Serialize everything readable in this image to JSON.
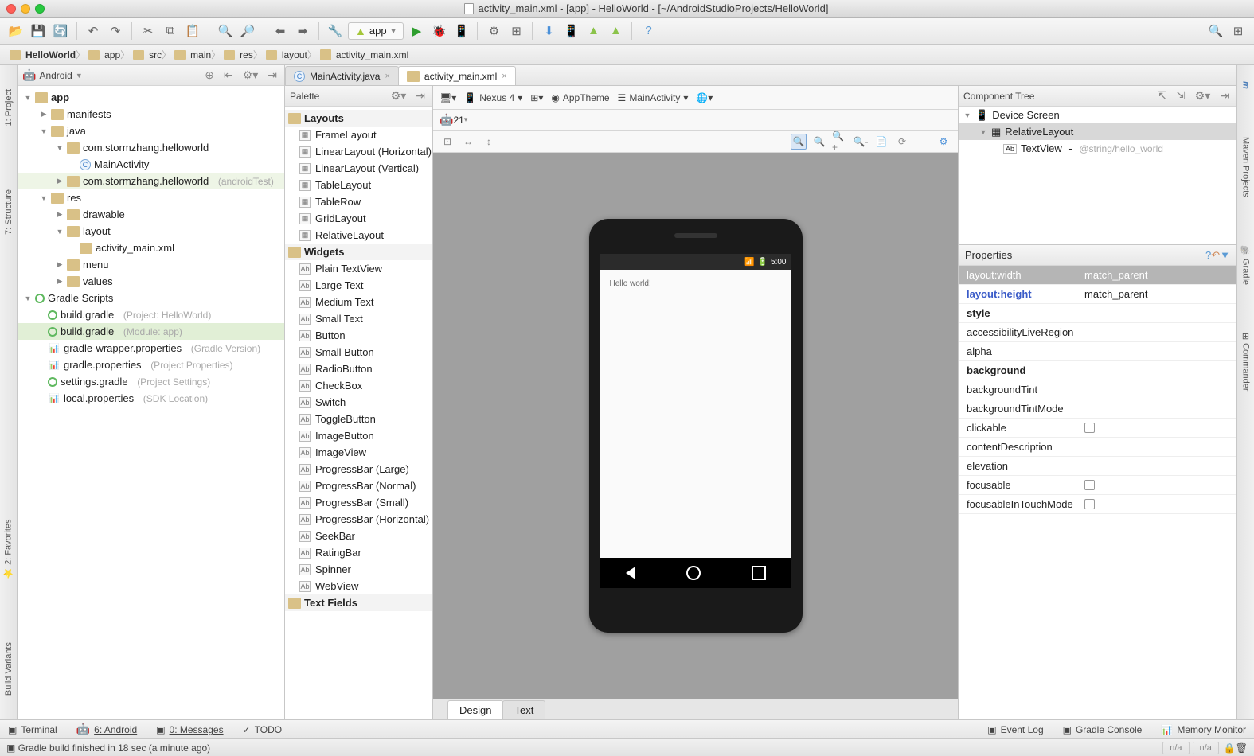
{
  "window_title": "activity_main.xml - [app] - HelloWorld - [~/AndroidStudioProjects/HelloWorld]",
  "app_selector": "app",
  "breadcrumb": [
    "HelloWorld",
    "app",
    "src",
    "main",
    "res",
    "layout",
    "activity_main.xml"
  ],
  "project_pane": {
    "mode": "Android",
    "tree": {
      "app": "app",
      "manifests": "manifests",
      "java": "java",
      "pkg1": "com.stormzhang.helloworld",
      "mainactivity": "MainActivity",
      "pkg2": "com.stormzhang.helloworld",
      "pkg2_hint": "(androidTest)",
      "res": "res",
      "drawable": "drawable",
      "layout": "layout",
      "layout_file": "activity_main.xml",
      "menu": "menu",
      "values": "values",
      "gradle_scripts": "Gradle Scripts",
      "bg1": "build.gradle",
      "bg1_hint": "(Project: HelloWorld)",
      "bg2": "build.gradle",
      "bg2_hint": "(Module: app)",
      "gwp": "gradle-wrapper.properties",
      "gwp_hint": "(Gradle Version)",
      "gp": "gradle.properties",
      "gp_hint": "(Project Properties)",
      "sg": "settings.gradle",
      "sg_hint": "(Project Settings)",
      "lp": "local.properties",
      "lp_hint": "(SDK Location)"
    }
  },
  "tabs": [
    {
      "label": "MainActivity.java",
      "active": false
    },
    {
      "label": "activity_main.xml",
      "active": true
    }
  ],
  "palette": {
    "title": "Palette",
    "layouts_label": "Layouts",
    "layouts": [
      "FrameLayout",
      "LinearLayout (Horizontal)",
      "LinearLayout (Vertical)",
      "TableLayout",
      "TableRow",
      "GridLayout",
      "RelativeLayout"
    ],
    "widgets_label": "Widgets",
    "widgets": [
      "Plain TextView",
      "Large Text",
      "Medium Text",
      "Small Text",
      "Button",
      "Small Button",
      "RadioButton",
      "CheckBox",
      "Switch",
      "ToggleButton",
      "ImageButton",
      "ImageView",
      "ProgressBar (Large)",
      "ProgressBar (Normal)",
      "ProgressBar (Small)",
      "ProgressBar (Horizontal)",
      "SeekBar",
      "RatingBar",
      "Spinner",
      "WebView"
    ],
    "textfields_label": "Text Fields"
  },
  "designer": {
    "device": "Nexus 4",
    "theme": "AppTheme",
    "activity": "MainActivity",
    "api": "21",
    "status_time": "5:00",
    "app_text": "Hello world!"
  },
  "component_tree": {
    "title": "Component Tree",
    "root": "Device Screen",
    "rl": "RelativeLayout",
    "tv": "TextView",
    "tv_hint": "@string/hello_world"
  },
  "properties": {
    "title": "Properties",
    "rows": [
      {
        "k": "layout:width",
        "v": "match_parent",
        "hdr": true
      },
      {
        "k": "layout:height",
        "v": "match_parent",
        "blue": true
      },
      {
        "k": "style",
        "v": "",
        "bold": true
      },
      {
        "k": "accessibilityLiveRegion",
        "v": ""
      },
      {
        "k": "alpha",
        "v": ""
      },
      {
        "k": "background",
        "v": "",
        "bold": true
      },
      {
        "k": "backgroundTint",
        "v": ""
      },
      {
        "k": "backgroundTintMode",
        "v": ""
      },
      {
        "k": "clickable",
        "v": "",
        "check": true
      },
      {
        "k": "contentDescription",
        "v": ""
      },
      {
        "k": "elevation",
        "v": ""
      },
      {
        "k": "focusable",
        "v": "",
        "check": true
      },
      {
        "k": "focusableInTouchMode",
        "v": "",
        "check": true
      }
    ]
  },
  "design_tabs": {
    "design": "Design",
    "text": "Text"
  },
  "bottom": {
    "terminal": "Terminal",
    "android": "6: Android",
    "messages": "0: Messages",
    "todo": "TODO",
    "eventlog": "Event Log",
    "gradleconsole": "Gradle Console",
    "memory": "Memory Monitor"
  },
  "status": "Gradle build finished in 18 sec (a minute ago)",
  "na": "n/a",
  "left_tools": {
    "project": "1: Project",
    "structure": "7: Structure",
    "favorites": "2: Favorites",
    "buildvariants": "Build Variants"
  },
  "right_tools": {
    "maven": "Maven Projects",
    "gradle": "Gradle",
    "commander": "Commander"
  }
}
